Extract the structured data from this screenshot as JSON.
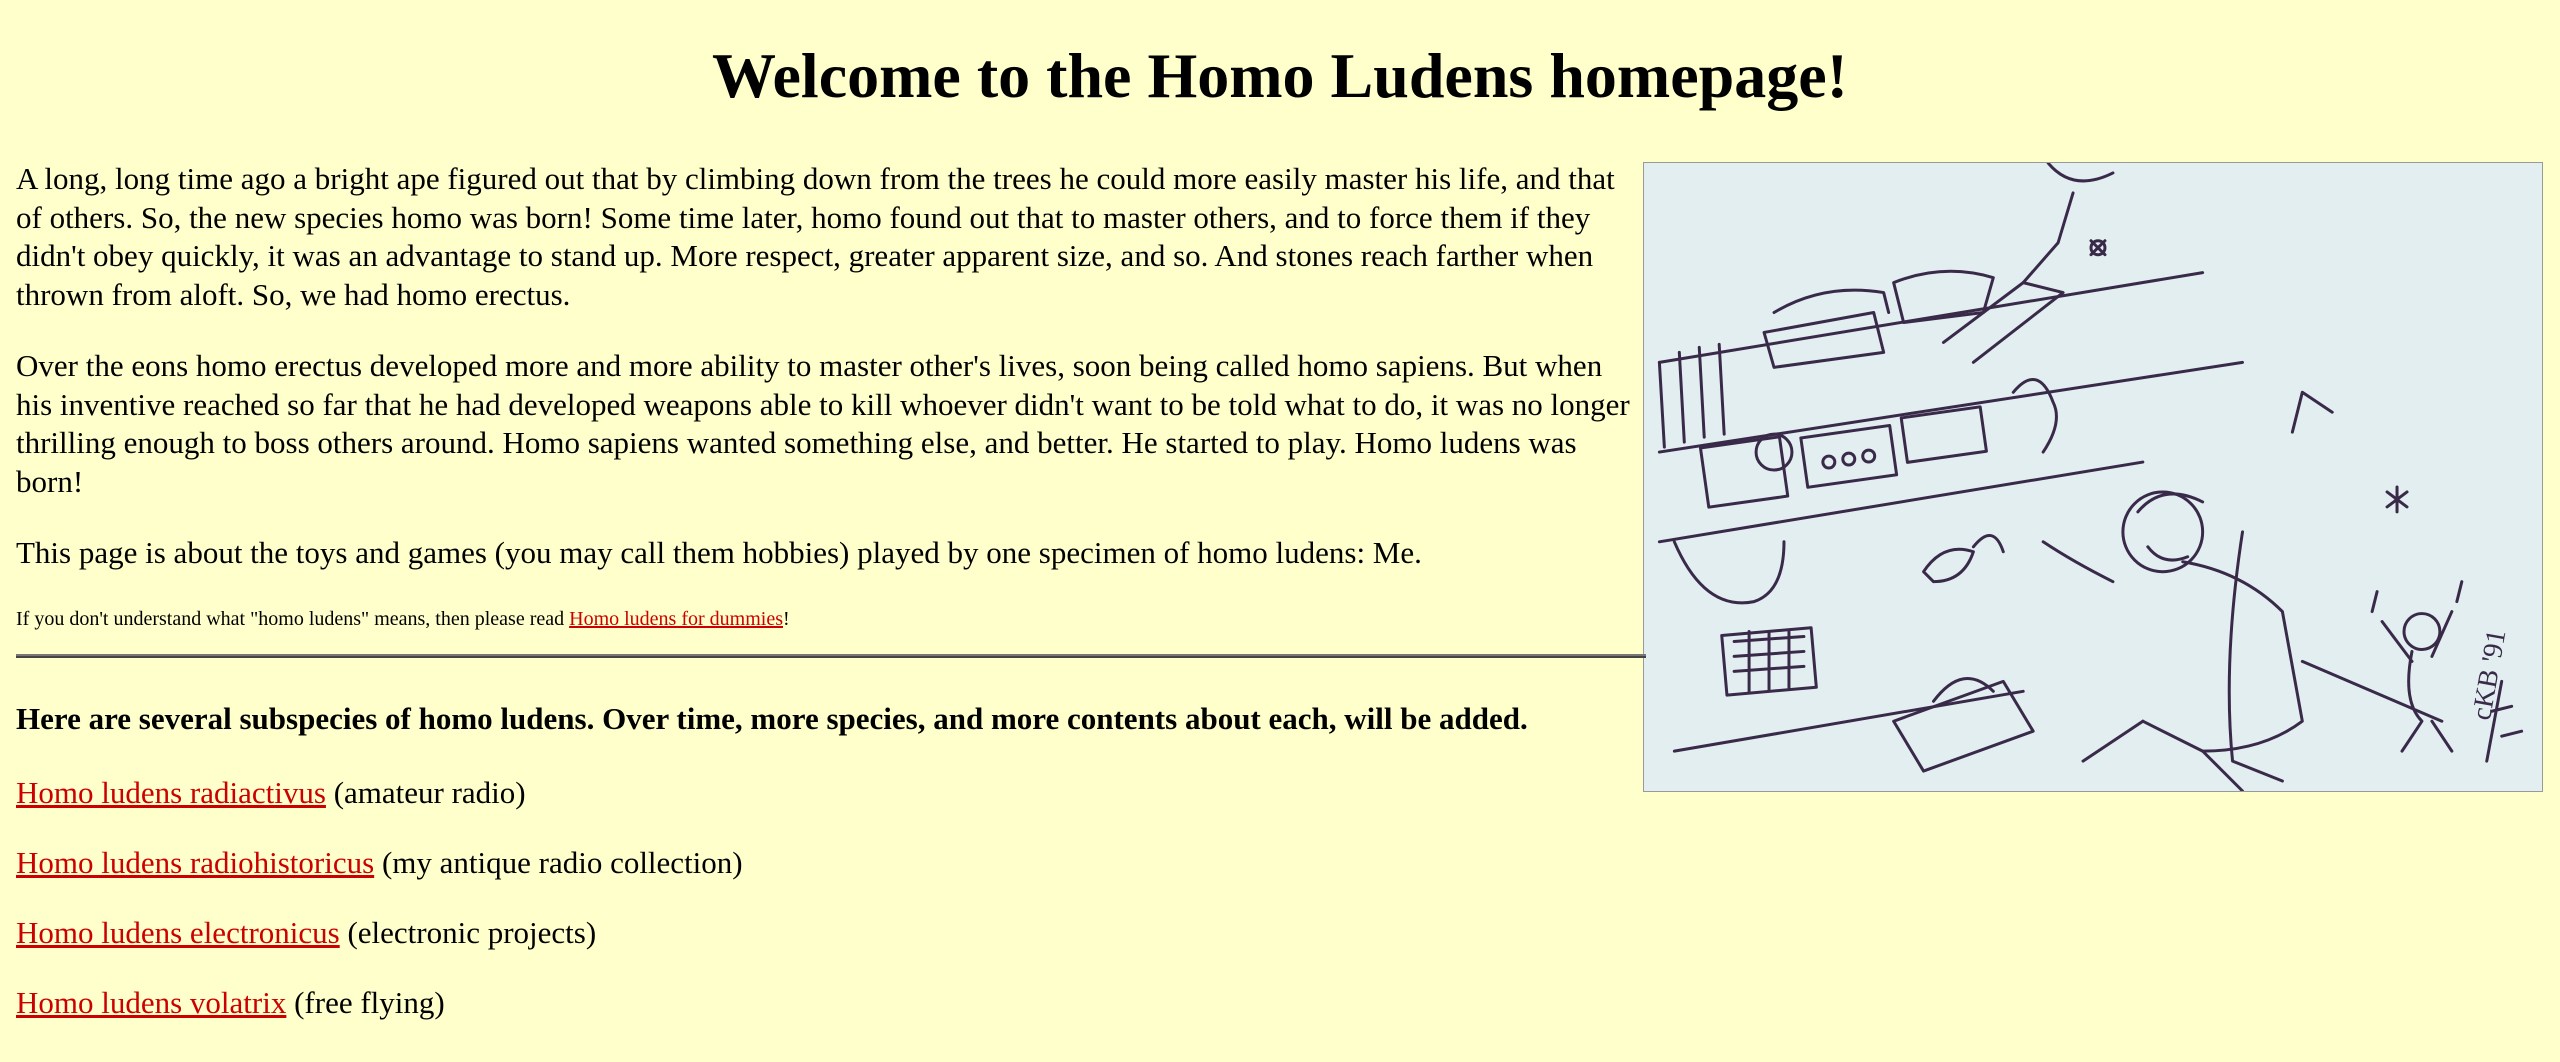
{
  "page": {
    "title": "Welcome to the Homo Ludens homepage!"
  },
  "intro": {
    "p1": "A long, long time ago a bright ape figured out that by climbing down from the trees he could more easily master his life, and that of others. So, the new species homo was born! Some time later, homo found out that to master others, and to force them if they didn't obey quickly, it was an advantage to stand up. More respect, greater apparent size, and so. And stones reach farther when thrown from aloft. So, we had homo erectus.",
    "p2": "Over the eons homo erectus developed more and more ability to master other's lives, soon being called homo sapiens. But when his inventive reached so far that he had developed weapons able to kill whoever didn't want to be told what to do, it was no longer thrilling enough to boss others around. Homo sapiens wanted something else, and better. He started to play. Homo ludens was born!",
    "p3": "This page is about the toys and games (you may call them hobbies) played by one specimen of homo ludens: Me.",
    "note_prefix": "If you don't understand what \"homo ludens\" means, then please read ",
    "note_link": "Homo ludens for dummies",
    "note_suffix": "!"
  },
  "subspecies": {
    "lead": "Here are several subspecies of homo ludens. Over time, more species, and more contents about each, will be added.",
    "items": [
      {
        "link": "Homo ludens radiactivus",
        "desc": " (amateur radio)"
      },
      {
        "link": "Homo ludens radiohistoricus",
        "desc": " (my antique radio collection)"
      },
      {
        "link": "Homo ludens electronicus",
        "desc": " (electronic projects)"
      },
      {
        "link": "Homo ludens volatrix",
        "desc": " (free flying)"
      }
    ]
  },
  "image": {
    "signature": "cKB '91"
  },
  "colors": {
    "background": "#ffffcc",
    "link": "#cc0000",
    "sketch_ink": "#3a2a4a",
    "sketch_paper": "#e2eef0"
  }
}
